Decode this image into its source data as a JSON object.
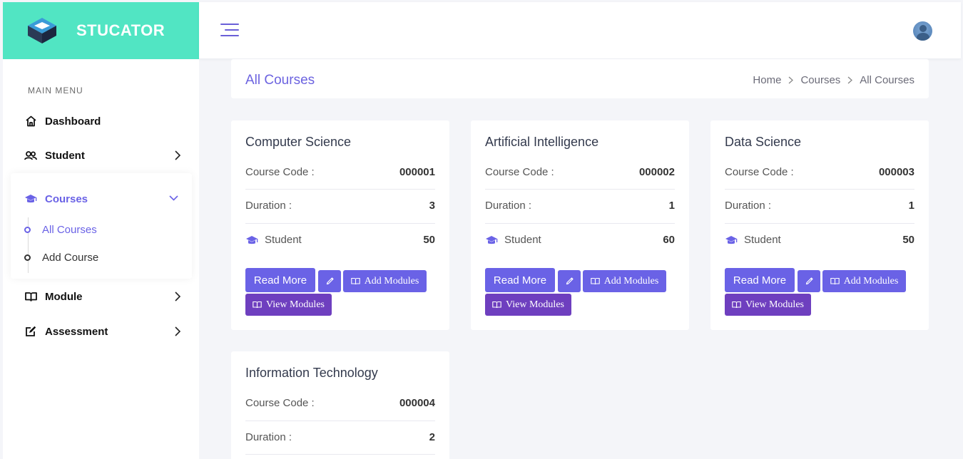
{
  "brand": {
    "name": "STUCATOR",
    "accent": "#51e5c3",
    "primary": "#6a62e6"
  },
  "header": {
    "menu_icon": "hamburger-icon",
    "avatar": "user-avatar"
  },
  "sidebar": {
    "menu_title": "MAIN MENU",
    "items": [
      {
        "label": "Dashboard",
        "icon": "home-icon"
      },
      {
        "label": "Student",
        "icon": "users-icon"
      },
      {
        "label": "Courses",
        "icon": "graduation-cap-icon"
      },
      {
        "label": "Module",
        "icon": "book-icon"
      },
      {
        "label": "Assessment",
        "icon": "edit-icon"
      }
    ],
    "courses_sub": [
      {
        "label": "All Courses"
      },
      {
        "label": "Add Course"
      }
    ]
  },
  "page": {
    "title": "All Courses",
    "breadcrumb": [
      "Home",
      "Courses",
      "All Courses"
    ]
  },
  "labels": {
    "course_code": "Course Code :",
    "duration": "Duration :",
    "student": "Student",
    "read_more": "Read More",
    "add_modules": "Add Modules",
    "view_modules": "View Modules"
  },
  "courses": [
    {
      "name": "Computer Science",
      "code": "000001",
      "duration": "3",
      "students": "50"
    },
    {
      "name": "Artificial Intelligence",
      "code": "000002",
      "duration": "1",
      "students": "60"
    },
    {
      "name": "Data Science",
      "code": "000003",
      "duration": "1",
      "students": "50"
    },
    {
      "name": "Information Technology",
      "code": "000004",
      "duration": "2"
    }
  ]
}
